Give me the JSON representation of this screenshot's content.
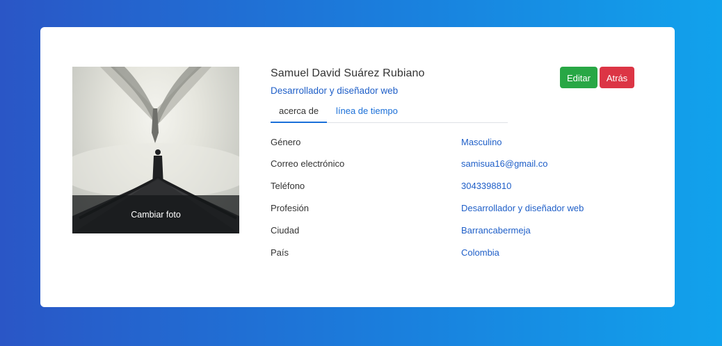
{
  "profile": {
    "name": "Samuel David Suárez Rubiano",
    "role": "Desarrollador y diseñador web",
    "photo_action": "Cambiar foto"
  },
  "actions": {
    "edit_label": "Editar",
    "back_label": "Atrás"
  },
  "tabs": [
    {
      "label": "acerca de",
      "active": true
    },
    {
      "label": "línea de tiempo",
      "active": false
    }
  ],
  "details": [
    {
      "label": "Género",
      "value": "Masculino"
    },
    {
      "label": "Correo electrónico",
      "value": "samisua16@gmail.co"
    },
    {
      "label": "Teléfono",
      "value": "3043398810"
    },
    {
      "label": "Profesión",
      "value": "Desarrollador y diseñador web"
    },
    {
      "label": "Ciudad",
      "value": "Barrancabermeja"
    },
    {
      "label": "País",
      "value": "Colombia"
    }
  ],
  "colors": {
    "background_start": "#2a56c6",
    "background_end": "#11a2ec",
    "link": "#1f5fc8",
    "edit_button": "#28a745",
    "back_button": "#dc3545"
  }
}
